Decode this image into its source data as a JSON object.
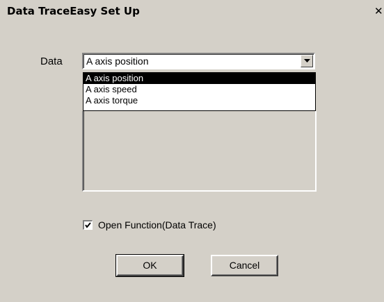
{
  "window": {
    "title": "Data TraceEasy Set Up",
    "close_glyph": "✕"
  },
  "data_field": {
    "label": "Data",
    "selected_value": "A axis position",
    "options": [
      {
        "label": "A axis position",
        "selected": true
      },
      {
        "label": "A axis speed",
        "selected": false
      },
      {
        "label": "A axis torque",
        "selected": false
      }
    ]
  },
  "open_function": {
    "label": "Open Function(Data Trace)",
    "checked": true
  },
  "buttons": {
    "ok_label": "OK",
    "cancel_label": "Cancel"
  },
  "icons": {
    "close": "close-icon",
    "dropdown": "chevron-down-icon",
    "check": "checkmark-icon"
  },
  "colors": {
    "face": "#d4d0c8",
    "selection": "#000000",
    "field_bg": "#ffffff"
  }
}
